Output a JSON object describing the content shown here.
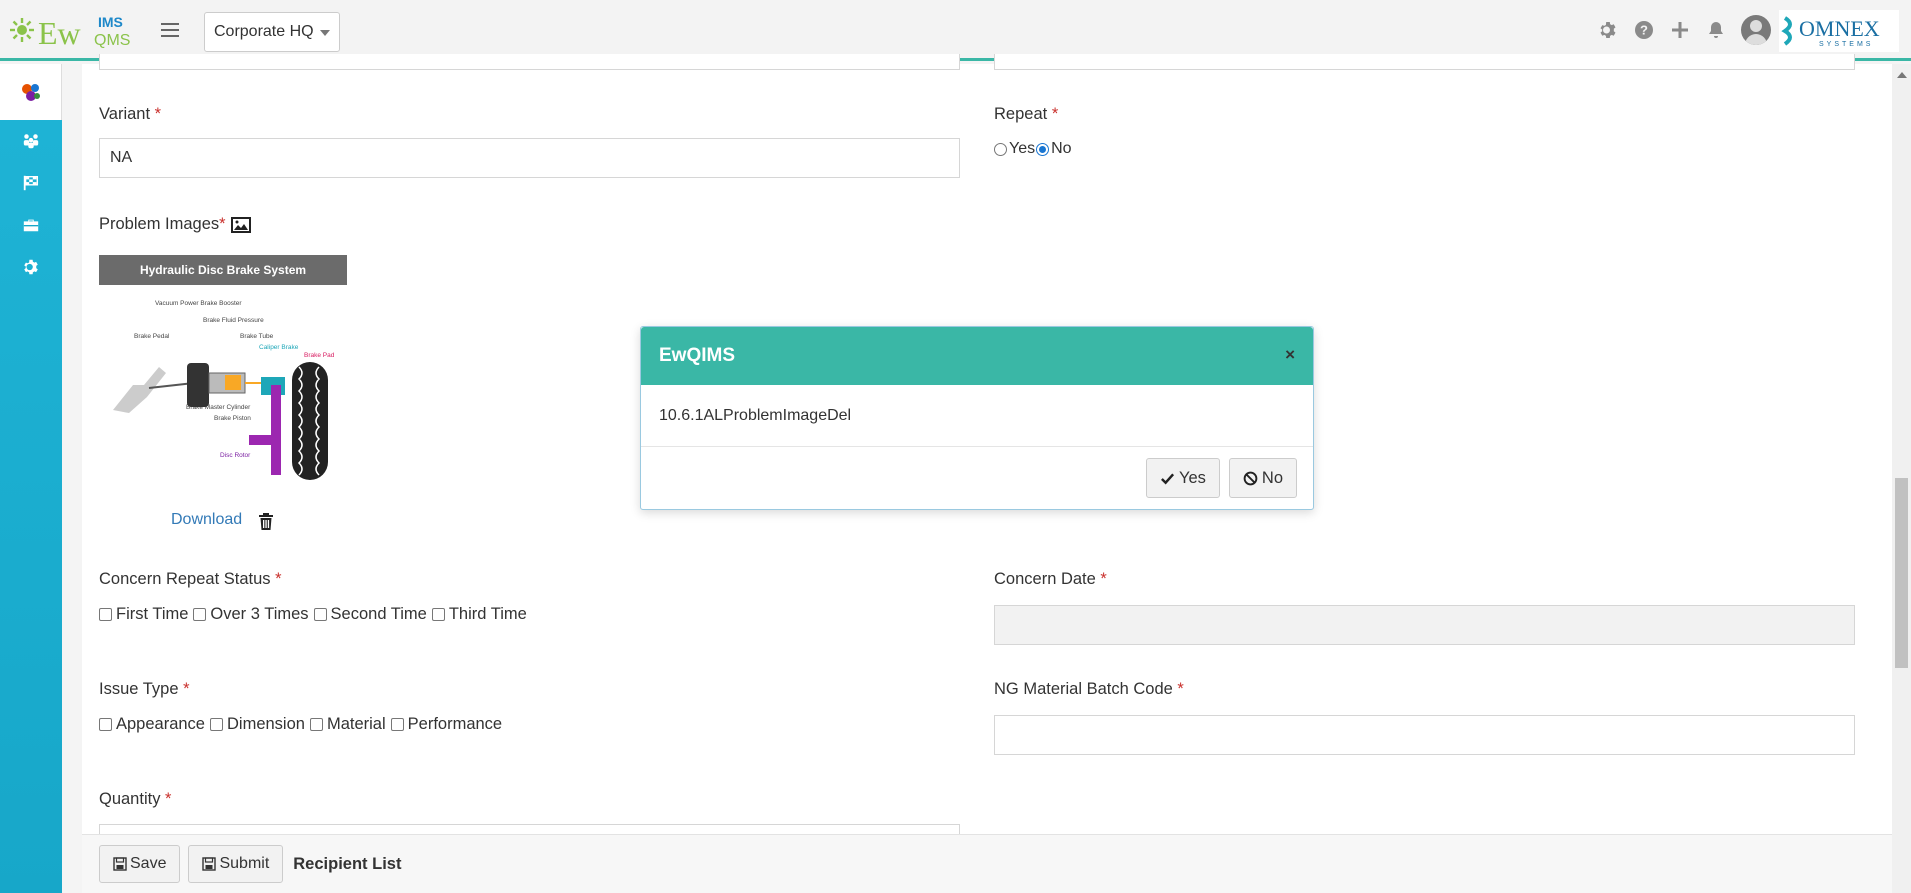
{
  "header": {
    "logo_text": "EwQMS",
    "logo_sup": "IMS",
    "site_selected": "Corporate HQ",
    "brand_right": "OMNEX",
    "brand_right_sub": "SYSTEMS",
    "icons": [
      "gear-icon",
      "help-icon",
      "plus-icon",
      "bell-icon",
      "avatar"
    ]
  },
  "sidebar": {
    "items": [
      "dashboard-icon",
      "team-icon",
      "flag-icon",
      "toolbox-icon",
      "settings-icon"
    ]
  },
  "form": {
    "variant": {
      "label": "Variant",
      "required": "*",
      "value": "NA"
    },
    "repeat": {
      "label": "Repeat",
      "required": "*",
      "options": [
        "Yes",
        "No"
      ],
      "selected": "No"
    },
    "problem_images": {
      "label": "Problem Images",
      "required": "*",
      "image_title": "Hydraulic Disc Brake System",
      "download_label": "Download"
    },
    "concern_repeat_status": {
      "label": "Concern Repeat Status",
      "required": "*",
      "options": [
        "First Time",
        "Over 3 Times",
        "Second Time",
        "Third Time"
      ]
    },
    "concern_date": {
      "label": "Concern Date",
      "required": "*",
      "value": ""
    },
    "issue_type": {
      "label": "Issue Type",
      "required": "*",
      "options": [
        "Appearance",
        "Dimension",
        "Material",
        "Performance"
      ]
    },
    "ng_batch_code": {
      "label": "NG Material Batch Code",
      "required": "*",
      "value": ""
    },
    "quantity": {
      "label": "Quantity",
      "required": "*"
    }
  },
  "footer": {
    "save_label": "Save",
    "submit_label": "Submit",
    "title": "Recipient List"
  },
  "modal": {
    "title": "EwQIMS",
    "close": "×",
    "message": "10.6.1ALProblemImageDel",
    "yes_label": "Yes",
    "no_label": "No"
  },
  "diagram_labels": {
    "booster": "Vacuum Power Brake Booster",
    "fluid": "Brake Fluid Pressure",
    "tube": "Brake Tube",
    "pedal": "Brake Pedal",
    "caliper": "Caliper Brake",
    "pad": "Brake Pad",
    "master": "Brake Master Cylinder",
    "piston": "Brake Piston",
    "rotor": "Disc Rotor"
  },
  "colors": {
    "accent": "#3ab7a6",
    "sidebar": "#1fb4d6",
    "required": "#c9302c",
    "link": "#337ab7"
  }
}
